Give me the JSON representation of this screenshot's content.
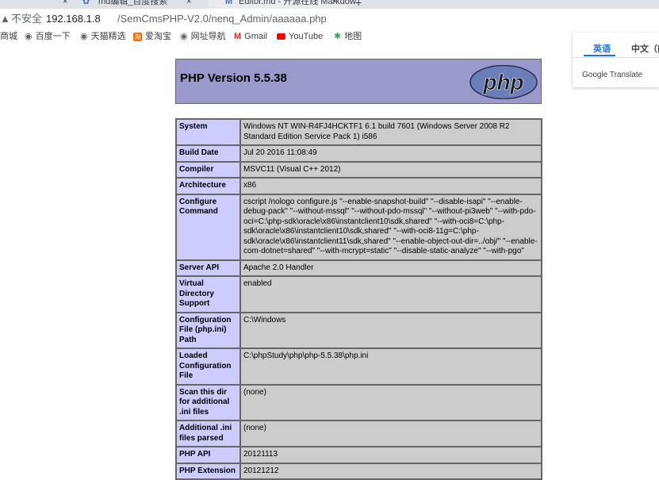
{
  "browser": {
    "tabs": [
      {
        "title": "",
        "close": "×"
      },
      {
        "title": "md编辑_百度搜索",
        "close": "×"
      },
      {
        "title": "Editor.md - 开源在线 Markdow",
        "close": "×"
      }
    ],
    "new_tab": "+",
    "address": {
      "security_label": "不安全",
      "separator": "|",
      "host": "192.168.1.8",
      "path": "/SemCmsPHP-V2.0/nenq_Admin/aaaaaa.php"
    },
    "bookmarks": [
      {
        "label": "商城",
        "icon": ""
      },
      {
        "label": "百度一下",
        "icon": "globe-icon"
      },
      {
        "label": "天猫精选",
        "icon": "globe-icon"
      },
      {
        "label": "爱淘宝",
        "icon": "taobao-icon"
      },
      {
        "label": "网址导航",
        "icon": "globe-icon"
      },
      {
        "label": "Gmail",
        "icon": "gmail-icon"
      },
      {
        "label": "YouTube",
        "icon": "youtube-icon"
      },
      {
        "label": "地图",
        "icon": "maps-icon"
      }
    ]
  },
  "translate_popup": {
    "tab_source": "英语",
    "tab_target": "中文（简",
    "brand": "Google Translate"
  },
  "phpinfo": {
    "title": "PHP Version 5.5.38",
    "logo_text": "php",
    "rows": [
      {
        "label": "System",
        "value": "Windows NT WIN-R4FJ4HCKTF1 6.1 build 7601 (Windows Server 2008 R2 Standard Edition Service Pack 1) i586"
      },
      {
        "label": "Build Date",
        "value": "Jul 20 2016 11:08:49"
      },
      {
        "label": "Compiler",
        "value": "MSVC11 (Visual C++ 2012)"
      },
      {
        "label": "Architecture",
        "value": "x86"
      },
      {
        "label": "Configure Command",
        "value": "cscript /nologo configure.js \"--enable-snapshot-build\" \"--disable-isapi\" \"--enable-debug-pack\" \"--without-mssql\" \"--without-pdo-mssql\" \"--without-pi3web\" \"--with-pdo-oci=C:\\php-sdk\\oracle\\x86\\instantclient10\\sdk,shared\" \"--with-oci8=C:\\php-sdk\\oracle\\x86\\instantclient10\\sdk,shared\" \"--with-oci8-11g=C:\\php-sdk\\oracle\\x86\\instantclient11\\sdk,shared\" \"--enable-object-out-dir=../obj/\" \"--enable-com-dotnet=shared\" \"--with-mcrypt=static\" \"--disable-static-analyze\" \"--with-pgo\""
      },
      {
        "label": "Server API",
        "value": "Apache 2.0 Handler"
      },
      {
        "label": "Virtual Directory Support",
        "value": "enabled"
      },
      {
        "label": "Configuration File (php.ini) Path",
        "value": "C:\\Windows"
      },
      {
        "label": "Loaded Configuration File",
        "value": "C:\\phpStudy\\php\\php-5.5.38\\php.ini"
      },
      {
        "label": "Scan this dir for additional .ini files",
        "value": "(none)"
      },
      {
        "label": "Additional .ini files parsed",
        "value": "(none)"
      },
      {
        "label": "PHP API",
        "value": "20121113"
      },
      {
        "label": "PHP Extension",
        "value": "20121212"
      }
    ]
  }
}
